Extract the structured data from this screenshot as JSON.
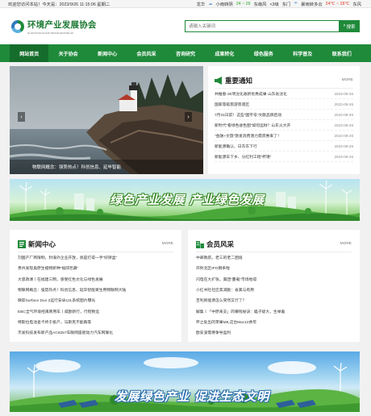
{
  "topbar": {
    "welcome": "欢迎您访问本站！今天是：2023/9/26 11:15:06 星期二",
    "city1": "龙华",
    "w1_cond": "小雨转阴",
    "w1_temp": "24 ~ 26",
    "w1_wind": "东南风",
    "w1_level": "<3级",
    "city2": "东门",
    "w2_cond": "暴雨转多云",
    "w2_temp": "24℃ ~ 28℃",
    "w2_wind": "东风"
  },
  "header": {
    "logo_cn": "环境产业发展协会",
    "logo_en": "HUANJINGCHANYEFAZHANXIEHUI",
    "search_placeholder": "请输入关键词",
    "search_label": "搜索"
  },
  "nav": [
    "网站首页",
    "关于协会",
    "新闻中心",
    "会员风采",
    "咨询研究",
    "成果转化",
    "绿色服务",
    "科学普及",
    "联系我们"
  ],
  "slider": {
    "caption": "物联网概念：强势热点！科创信息、延毕智能"
  },
  "notice": {
    "title": "重要通知",
    "more": "MORE",
    "items": [
      {
        "text": "共推春-30项沈化收新优秀成果 山东省沈化",
        "date": "2023-09-26"
      },
      {
        "text": "国家等级旅游景观区",
        "date": "2023-09-26"
      },
      {
        "text": "7月31日前！这些“国字号”文献品牌启动",
        "date": "2023-09-26"
      },
      {
        "text": "新时代“看绿色收色图”如何运财？山东火大开",
        "date": "2023-09-26"
      },
      {
        "text": "“金融+文旅”激发消费潜力需赏惠来了！",
        "date": "2023-09-26"
      },
      {
        "text": "新能源确认、日东东下行",
        "date": "2023-09-26"
      },
      {
        "text": "新能源车下乡、分红利工程“杯珉”",
        "date": "2023-09-26"
      }
    ]
  },
  "banner1": {
    "text": "绿色产业发展 产业绿色发展"
  },
  "news": {
    "title": "新闻中心",
    "more": "MORE",
    "items": [
      "刘国产厂商限制，封海外企业开放，真是打得一手“好牌盒”",
      "贵州发现奥原生植物新种“福邱巨藏”",
      "大思政课丨在福建三明，感受红色文化与绿色发展",
      "物联网概念：强势热点！科创信息、延毕智能寄生用物联网大陆",
      "微软Surface Duo 2运行安卓12L系统图片曝光",
      "EBC全气环境经再商用车丨威欧新行，行稳致远",
      "特斯拉电池查卡终于投产，马斯克不能再等",
      "杰发科技发布新产品AC8257车联网座舱动力汽车网联化"
    ]
  },
  "members": {
    "title": "会员风采",
    "more": "MORE",
    "items": [
      "中邮教航，老三的老二困境",
      "开封北区IPO倒条啦",
      "闪电在大扩张，美团“蔓载”市场地得",
      "小红书社社区高减励：省美与有用",
      "吉利新能源怎么突然又行了？",
      "解集丨「中原来支」的赚钱秘诀：瞌子级大，生举着",
      "怀之处出的苹果M8,这台Mac10余年",
      "欧安波需要争导盈利"
    ]
  },
  "banner2": {
    "text": "发展绿色产业 促进生态文明"
  },
  "colors": {
    "brand_green": "#1f8a3a",
    "nav_active": "#156d2b"
  }
}
